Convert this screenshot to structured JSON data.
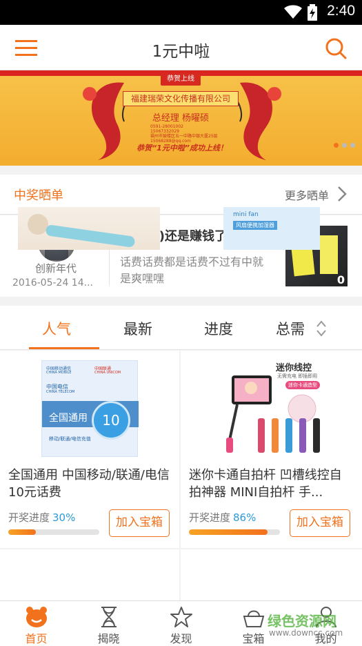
{
  "status_bar": {
    "time": "2:40"
  },
  "app_bar": {
    "title": "1元中啦"
  },
  "banner": {
    "ribbon": "恭贺上线",
    "company": "福建瑞荣文化传播有限公司",
    "manager": "总经理 杨曜硕",
    "details": [
      "0591-28001002",
      "15067332029",
      "福州市鼓楼区五一中路中银大厦25层",
      "15068288@qq.com"
    ],
    "slogan": "恭贺“1元中啦”成功上线！",
    "slide_count": 3,
    "active_slide": 0
  },
  "winners": {
    "section_label": "中奖晒单",
    "more_label": "更多晒单",
    "item": {
      "user_name": "创新年代",
      "date": "2016-05-24 14...",
      "headline": "(第1期)还是赚钱了谢谢...",
      "body": "话费话费都是话费不过有中就是爽嘿嘿",
      "photo_count": "0"
    }
  },
  "tabs": [
    {
      "label": "人气",
      "active": true
    },
    {
      "label": "最新",
      "active": false
    },
    {
      "label": "进度",
      "active": false
    },
    {
      "label": "总需",
      "active": false
    }
  ],
  "products": [
    {
      "title": "全国通用 中国移动/联通/电信 10元话费",
      "progress_label": "开奖进度",
      "progress_text": "30%",
      "progress": 0.3,
      "add_label": "加入宝箱",
      "image": {
        "cmcc": "中国移动通信",
        "cmcc_en": "CHINA MOBILE",
        "unicom": "中国联通",
        "unicom_en": "CHINA UNICOM",
        "telecom": "中国电信",
        "telecom_en": "CHINA TELECOM",
        "national": "全国通用",
        "small": "移动/联通/电信充值",
        "badge": "10"
      }
    },
    {
      "title": "迷你卡通自拍杆 凹槽线控自拍神器 MINI自拍杆 手...",
      "progress_label": "开奖进度",
      "progress_text": "86%",
      "progress": 0.86,
      "add_label": "加入宝箱",
      "image": {
        "header": "迷你线控",
        "sub": "无需充电 即插即用",
        "pill": "迷你卡通造型"
      }
    }
  ],
  "more_products": [
    {
      "image": {}
    },
    {
      "image": {
        "t1": "mini fan",
        "t2": "风扇便携加湿器"
      }
    }
  ],
  "tabbar": [
    {
      "label": "首页",
      "icon": "home-face-icon",
      "active": true
    },
    {
      "label": "揭晓",
      "icon": "hourglass-icon",
      "active": false
    },
    {
      "label": "发现",
      "icon": "star-icon",
      "active": false
    },
    {
      "label": "宝箱",
      "icon": "basket-icon",
      "active": false
    },
    {
      "label": "我的",
      "icon": "person-icon",
      "active": false
    }
  ],
  "watermark": {
    "line1": "绿色资源网",
    "line2": "www.downcc.com"
  },
  "colors": {
    "accent": "#f2711c",
    "progress_text": "#2d9ad8",
    "banner_bg": "#f3ad2f",
    "banner_red": "#c9301d"
  }
}
